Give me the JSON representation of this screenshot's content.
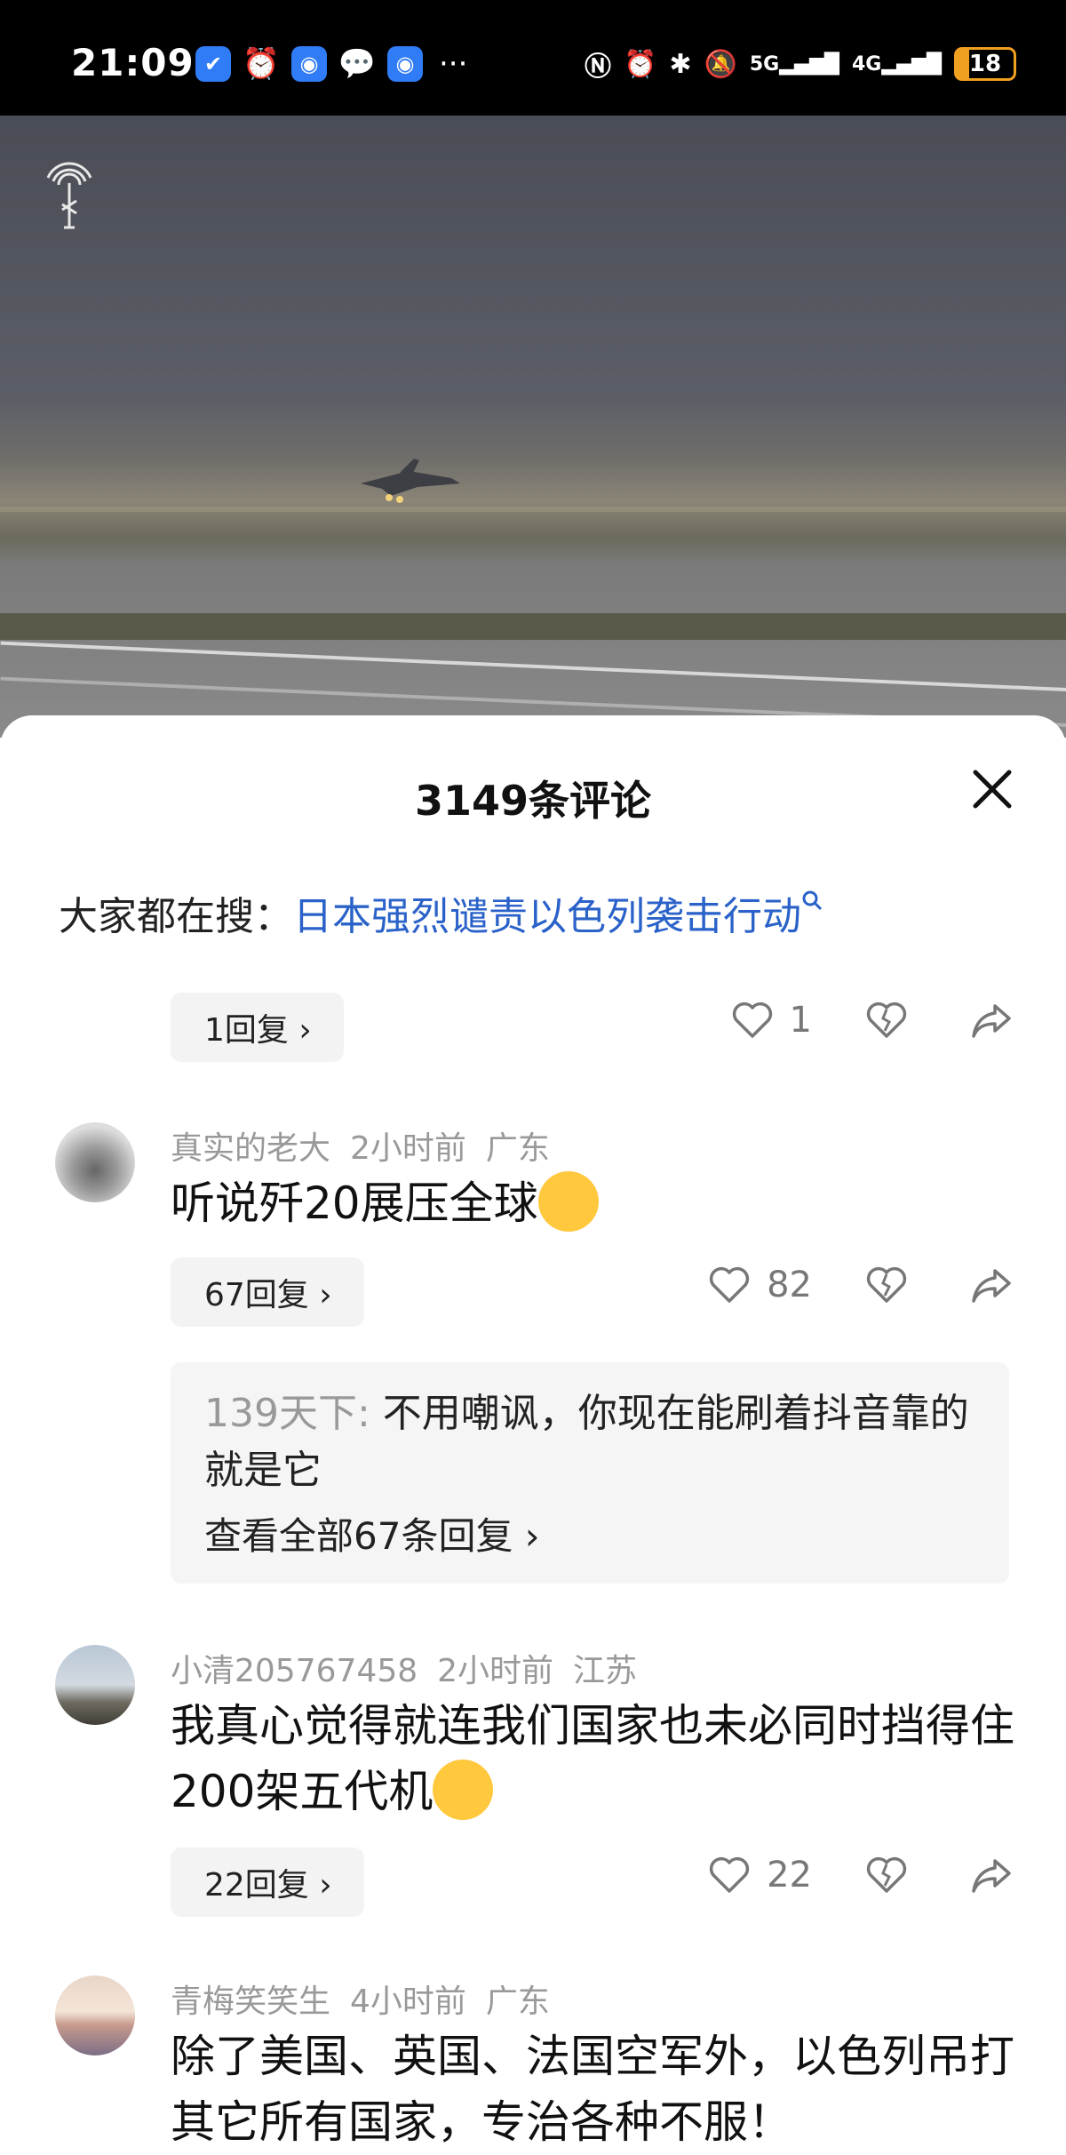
{
  "status_bar": {
    "time": "21:09",
    "signal_5g": "5G",
    "signal_4g": "4G",
    "battery": "18"
  },
  "sheet": {
    "title": "3149条评论",
    "search_prefix": "大家都在搜：",
    "search_link": "日本强烈谴责以色列袭击行动"
  },
  "comments": [
    {
      "replies_label": "1回复 ›",
      "likes": "1"
    },
    {
      "user": "真实的老大",
      "time": "2小时前",
      "location": "广东",
      "text": "听说歼20展压全球",
      "replies_label": "67回复 ›",
      "likes": "82",
      "sub_reply": {
        "user": "139天下:",
        "text": " 不用嘲讽，你现在能刷着抖音靠的就是它",
        "view_all": "查看全部67条回复 ›"
      }
    },
    {
      "user": "小清205767458",
      "time": "2小时前",
      "location": "江苏",
      "text": "我真心觉得就连我们国家也未必同时挡得住200架五代机",
      "replies_label": "22回复 ›",
      "likes": "22"
    },
    {
      "user": "青梅笑笑生",
      "time": "4小时前",
      "location": "广东",
      "text": "除了美国、英国、法国空军外，以色列吊打其它所有国家，专治各种不服！"
    }
  ]
}
